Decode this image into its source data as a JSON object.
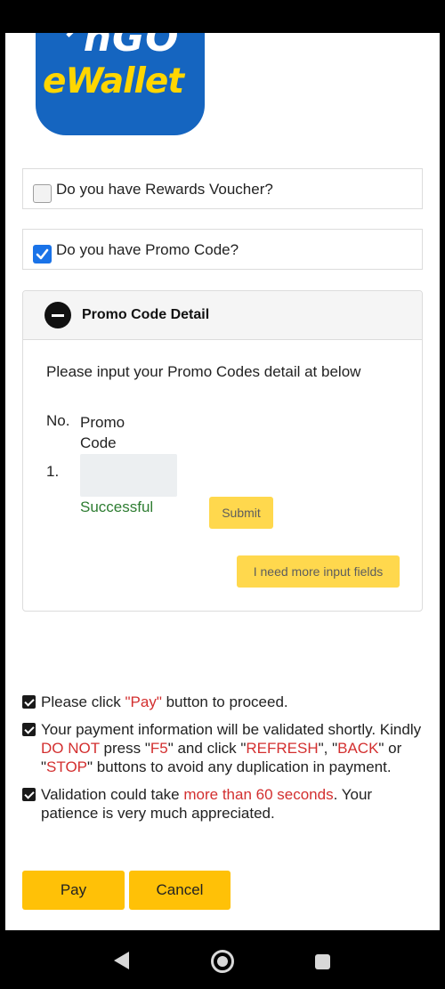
{
  "logo": {
    "line1": "ᐟnGO",
    "line2": "eWallet"
  },
  "rewards": {
    "label": "Do you have Rewards Voucher?",
    "checked": false
  },
  "promo": {
    "label": "Do you have Promo Code?",
    "checked": true
  },
  "promo_detail": {
    "title": "Promo Code Detail",
    "description": "Please input your Promo Codes detail at below",
    "col_no": "No.",
    "col_code": "Promo Code",
    "rows": [
      {
        "num": "1.",
        "code_value": "",
        "status": "Successful"
      }
    ],
    "submit_label": "Submit",
    "more_label": "I need more input fields"
  },
  "notes": {
    "n1": {
      "a": "Please click ",
      "b": "\"Pay\"",
      "c": " button to proceed."
    },
    "n2": {
      "a": "Your payment information will be validated shortly. Kindly ",
      "b": "DO NOT",
      "c": " press \"",
      "d": "F5",
      "e": "\" and click \"",
      "f": "REFRESH",
      "g": "\", \"",
      "h": "BACK",
      "i": "\" or \"",
      "j": "STOP",
      "k": "\" buttons to avoid any duplication in payment."
    },
    "n3": {
      "a": "Validation could take ",
      "b": "more than 60 seconds",
      "c": ". Your patience is very much appreciated."
    }
  },
  "actions": {
    "pay_label": "Pay",
    "cancel_label": "Cancel"
  },
  "colors": {
    "accent": "#ffc107",
    "logo_blue": "#1565c0",
    "logo_yellow": "#ffd600",
    "warning_red": "#d32f2f",
    "success_green": "#2e7d32"
  }
}
